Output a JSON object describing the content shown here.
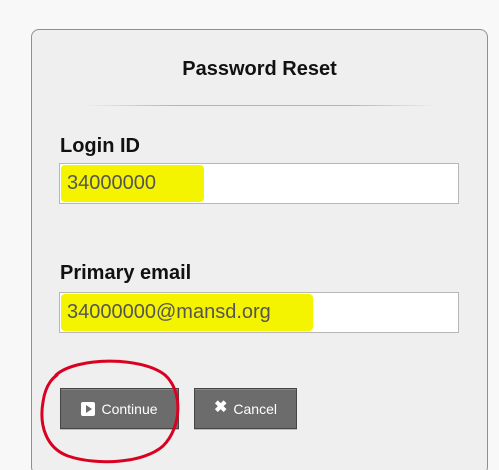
{
  "dialog": {
    "title": "Password Reset"
  },
  "login": {
    "label": "Login ID",
    "value": "34000000"
  },
  "email": {
    "label": "Primary email",
    "value": "34000000@mansd.org"
  },
  "actions": {
    "continue_label": "Continue",
    "cancel_label": "Cancel"
  },
  "icons": {
    "continue": "play-icon",
    "cancel": "close-icon"
  },
  "colors": {
    "highlight": "#f4f400",
    "annotation": "#d90022",
    "button": "#6c6c6c"
  }
}
